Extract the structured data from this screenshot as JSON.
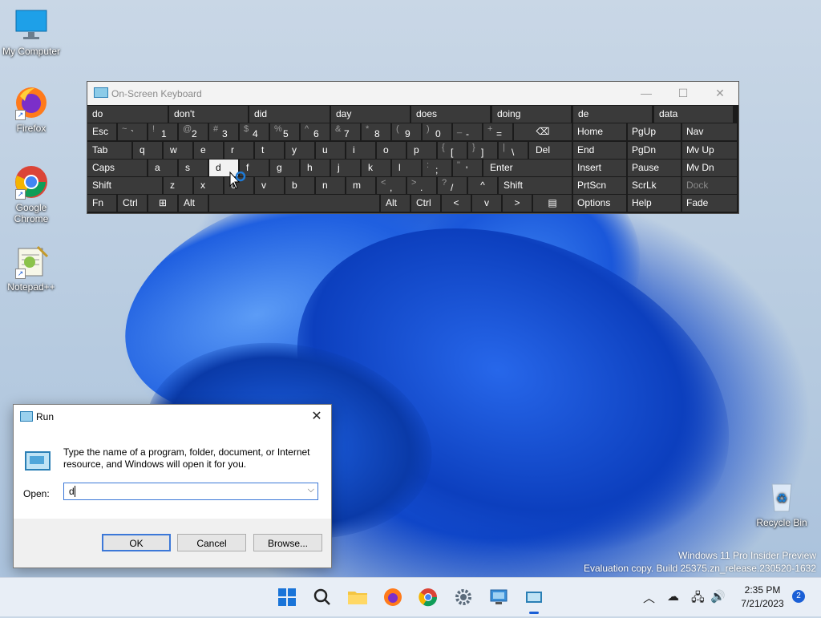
{
  "desktop_icons": [
    {
      "label": "My Computer",
      "icon": "monitor-icon"
    },
    {
      "label": "Firefox",
      "icon": "firefox-icon"
    },
    {
      "label": "Google Chrome",
      "icon": "chrome-icon"
    },
    {
      "label": "Notepad++",
      "icon": "notepadpp-icon"
    },
    {
      "label": "Recycle Bin",
      "icon": "recycle-bin-icon"
    }
  ],
  "osk": {
    "title": "On-Screen Keyboard",
    "predictions": [
      "do",
      "don't",
      "did",
      "day",
      "does",
      "doing",
      "de",
      "data"
    ],
    "row1": {
      "esc": "Esc",
      "pairs": [
        [
          "~",
          "`"
        ],
        [
          "!",
          "1"
        ],
        [
          "@",
          "2"
        ],
        [
          "#",
          "3"
        ],
        [
          "$",
          "4"
        ],
        [
          "%",
          "5"
        ],
        [
          "^",
          "6"
        ],
        [
          "&",
          "7"
        ],
        [
          "*",
          "8"
        ],
        [
          "(",
          "9"
        ],
        [
          ")",
          "0"
        ],
        [
          "_",
          "-"
        ],
        [
          "+",
          "="
        ]
      ],
      "backspace": "⌫"
    },
    "row2": {
      "tab": "Tab",
      "letters": [
        "q",
        "w",
        "e",
        "r",
        "t",
        "y",
        "u",
        "i",
        "o",
        "p"
      ],
      "pairs": [
        [
          "{",
          "["
        ],
        [
          "}",
          "]"
        ],
        [
          "|",
          "\\"
        ]
      ],
      "del": "Del"
    },
    "row3": {
      "caps": "Caps",
      "letters": [
        "a",
        "s",
        "d",
        "f",
        "g",
        "h",
        "j",
        "k",
        "l"
      ],
      "pairs": [
        [
          ":",
          ";"
        ],
        [
          "\"",
          "'"
        ]
      ],
      "enter": "Enter"
    },
    "row4": {
      "shift": "Shift",
      "letters": [
        "z",
        "x",
        "c",
        "v",
        "b",
        "n",
        "m"
      ],
      "pairs": [
        [
          "<",
          ","
        ],
        [
          ">",
          "."
        ],
        [
          "?",
          "/"
        ]
      ],
      "up": "^",
      "shift_r": "Shift"
    },
    "row5": {
      "fn": "Fn",
      "ctrl": "Ctrl",
      "win": "⊞",
      "alt": "Alt",
      "alt_r": "Alt",
      "ctrl_r": "Ctrl",
      "left": "<",
      "down": "v",
      "right": ">",
      "menu": "▤"
    },
    "nav": {
      "home": "Home",
      "pgup": "PgUp",
      "nav": "Nav",
      "end": "End",
      "pgdn": "PgDn",
      "mvup": "Mv Up",
      "insert": "Insert",
      "pause": "Pause",
      "mvdn": "Mv Dn",
      "prtscn": "PrtScn",
      "scrlk": "ScrLk",
      "dock": "Dock",
      "options": "Options",
      "help": "Help",
      "fade": "Fade"
    }
  },
  "run": {
    "title": "Run",
    "description": "Type the name of a program, folder, document, or Internet resource, and Windows will open it for you.",
    "open_label": "Open:",
    "open_value": "d",
    "ok": "OK",
    "cancel": "Cancel",
    "browse": "Browse..."
  },
  "watermark": {
    "line1": "Windows 11 Pro Insider Preview",
    "line2": "Evaluation copy. Build 25375.zn_release.230520-1632"
  },
  "taskbar": {
    "time": "2:35 PM",
    "date": "7/21/2023",
    "notifications": "2"
  }
}
